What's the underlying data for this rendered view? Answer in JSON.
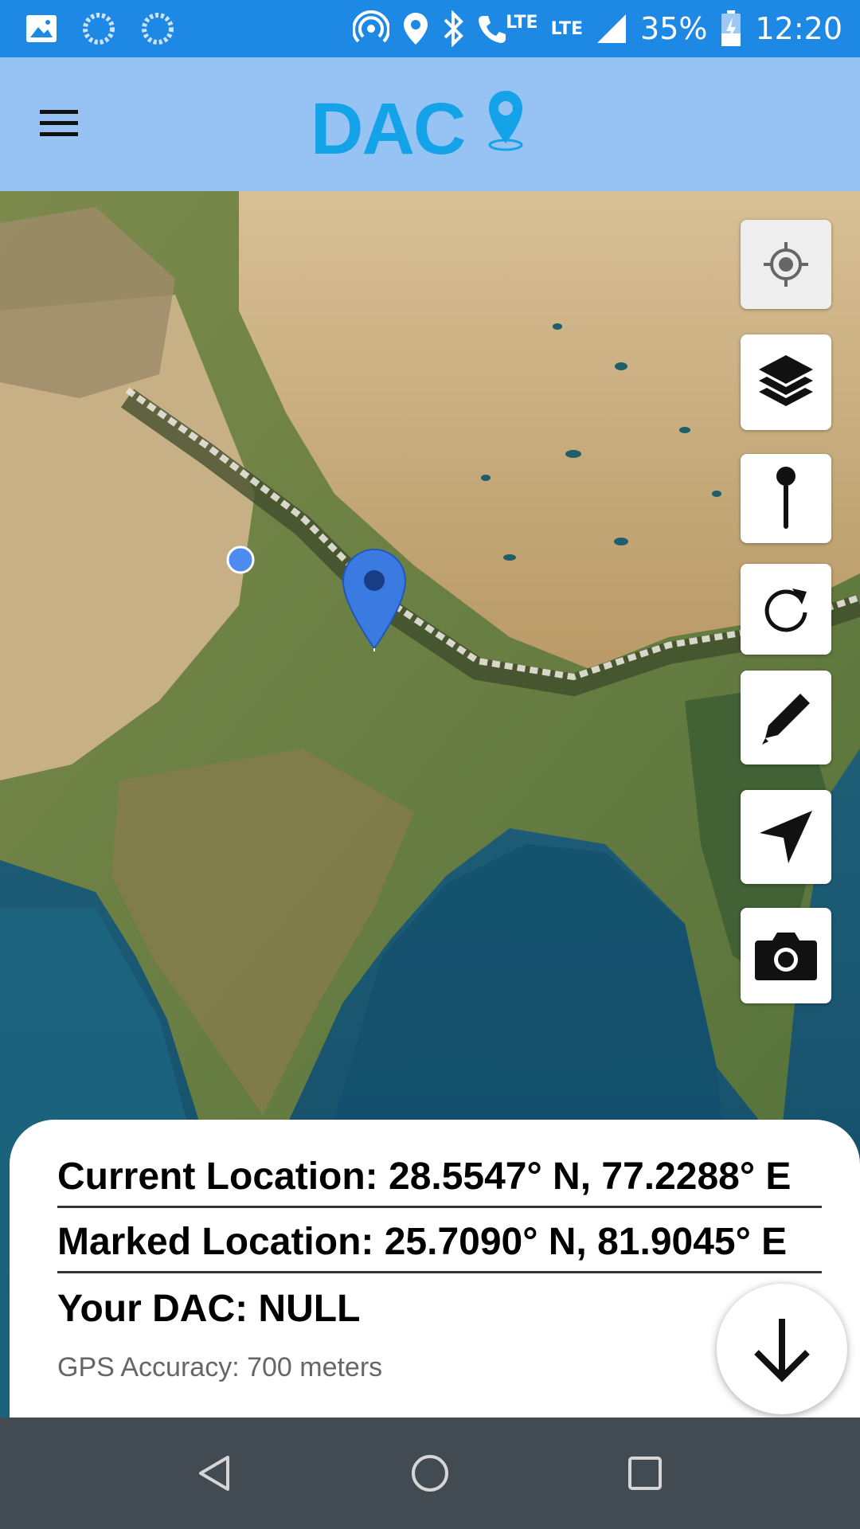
{
  "status_bar": {
    "lte1": "LTE",
    "lte2": "LTE",
    "battery": "35%",
    "time": "12:20",
    "icons_left": [
      "image-icon",
      "loading-icon",
      "loading-icon"
    ],
    "icons_right": [
      "hotspot-icon",
      "location-icon",
      "bluetooth-icon",
      "volte-call-icon",
      "signal-icon",
      "battery-charging-icon"
    ]
  },
  "app_bar": {
    "logo_text": "DAC",
    "menu_icon": "hamburger-menu-icon"
  },
  "map_controls": [
    {
      "name": "my-location-button",
      "icon": "crosshair-icon"
    },
    {
      "name": "layers-button",
      "icon": "layers-icon"
    },
    {
      "name": "drop-pin-button",
      "icon": "pin-icon"
    },
    {
      "name": "refresh-button",
      "icon": "refresh-icon"
    },
    {
      "name": "edit-button",
      "icon": "pencil-icon"
    },
    {
      "name": "navigate-button",
      "icon": "navigation-arrow-icon"
    },
    {
      "name": "camera-button",
      "icon": "camera-icon"
    }
  ],
  "info": {
    "current_location": "Current Location: 28.5547° N, 77.2288° E",
    "marked_location": "Marked Location: 25.7090° N, 81.9045° E",
    "your_dac": "Your DAC: NULL",
    "gps_accuracy": "GPS Accuracy: 700 meters"
  },
  "colors": {
    "status_bar": "#1e88e5",
    "app_bar": "#96c3f3",
    "logo": "#14a3e8",
    "marker": "#3b7ae0",
    "nav_bar": "#424a52"
  }
}
